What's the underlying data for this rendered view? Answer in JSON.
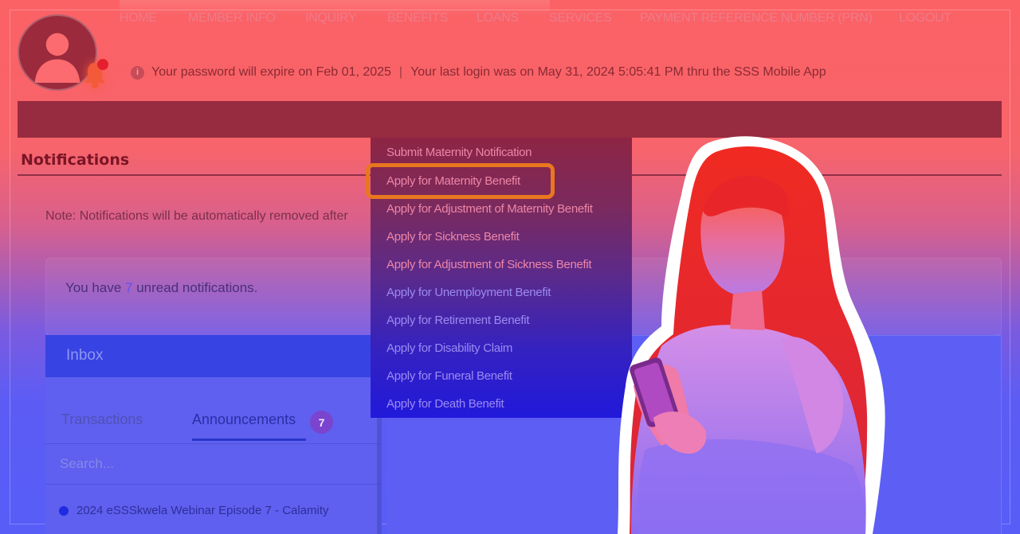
{
  "header": {
    "password_notice": "Your password will expire on Feb 01, 2025",
    "separator": "|",
    "last_login": "Your last login was on May 31, 2024 5:05:41 PM thru the SSS Mobile App",
    "info_icon": "i"
  },
  "nav": {
    "items": [
      {
        "label": "HOME"
      },
      {
        "label": "MEMBER INFO"
      },
      {
        "label": "INQUIRY"
      },
      {
        "label": "BENEFITS"
      },
      {
        "label": "LOANS"
      },
      {
        "label": "SERVICES"
      },
      {
        "label": "PAYMENT REFERENCE NUMBER (PRN)"
      },
      {
        "label": "LOGOUT"
      }
    ]
  },
  "benefits_menu": {
    "items": [
      {
        "label": "Submit Maternity Notification"
      },
      {
        "label": "Apply for Maternity Benefit"
      },
      {
        "label": "Apply for Adjustment of Maternity Benefit"
      },
      {
        "label": "Apply for Sickness Benefit"
      },
      {
        "label": "Apply for Adjustment of Sickness Benefit"
      },
      {
        "label": "Apply for Unemployment Benefit"
      },
      {
        "label": "Apply for Retirement Benefit"
      },
      {
        "label": "Apply for Disability Claim"
      },
      {
        "label": "Apply for Funeral Benefit"
      },
      {
        "label": "Apply for Death Benefit"
      }
    ],
    "highlighted": "Apply for Maternity Benefit"
  },
  "notifications": {
    "title": "Notifications",
    "note": "Note: Notifications will be automatically removed after",
    "unread_prefix": "You have",
    "unread_count": "7",
    "unread_suffix": "unread notifications."
  },
  "inbox": {
    "title": "Inbox",
    "tabs": [
      {
        "label": "Transactions"
      },
      {
        "label": "Announcements",
        "badge": "7"
      }
    ],
    "search_placeholder": "Search...",
    "first_item": "2024 eSSSkwela Webinar Episode 7 - Calamity"
  },
  "colors": {
    "nav_bg": "#972b3f",
    "highlight_border": "#e9771f",
    "inbox_header": "#3743e2"
  },
  "icons": [
    "user-avatar-icon",
    "bell-icon",
    "info-icon"
  ]
}
